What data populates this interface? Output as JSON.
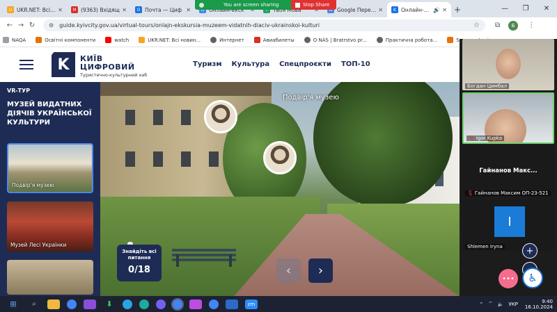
{
  "browser": {
    "tabs": [
      {
        "label": "UKR.NET: Всі но",
        "color": "#f5a623",
        "icon": "U"
      },
      {
        "label": "(9363) Вхідящ",
        "color": "#d93025",
        "icon": "M"
      },
      {
        "label": "Почта — Циф",
        "color": "#1a73e8",
        "icon": "O"
      },
      {
        "label": "Онлайн-екск",
        "color": "#4285f4",
        "icon": "O"
      },
      {
        "label": "Твоя Мова",
        "color": "#1fa463",
        "icon": "T"
      },
      {
        "label": "Google Перекл",
        "color": "#4285f4",
        "icon": "G"
      },
      {
        "label": "Онлайн-екс",
        "color": "#1a73e8",
        "icon": "K",
        "active": true
      }
    ],
    "new_tab": "+",
    "share": {
      "text": "You are screen sharing",
      "stop": "Stop Share"
    },
    "url": "guide.kyivcity.gov.ua/virtual-tours/onlajn-ekskursia-muzeem-vidatnih-diaciv-ukrainskoi-kulturi",
    "profile_initial": "Б",
    "bookmarks": [
      {
        "label": "NAQA",
        "color": "#9aa0a6"
      },
      {
        "label": "Освітні компоненти",
        "color": "#e8710a"
      },
      {
        "label": "watch",
        "color": "#ff0000"
      },
      {
        "label": "UKR.NET: Всі новин...",
        "color": "#f5a623"
      },
      {
        "label": "Интернет",
        "color": "#5f6368"
      },
      {
        "label": "Авиабилеты",
        "color": "#d93025"
      },
      {
        "label": "О NÁS | Bratrstvo pr...",
        "color": "#5f6368"
      },
      {
        "label": "Практична робота...",
        "color": "#5f6368"
      },
      {
        "label": "Scopus - Login",
        "color": "#e8710a"
      }
    ]
  },
  "site": {
    "brand_line1": "КИЇВ",
    "brand_line2": "ЦИФРОВИЙ",
    "brand_sub": "Туристично-культурний хаб",
    "logo_letter": "K",
    "menu": [
      "Туризм",
      "Культура",
      "Спецпроєкти",
      "ТОП-10"
    ],
    "sidebar": {
      "tag": "VR-ТУР",
      "title": "МУЗЕЙ ВИДАТНИХ ДІЯЧІВ УКРАЇНСЬКОЇ КУЛЬТУРИ",
      "cards": [
        "Подвір'я музею",
        "Музей Лесі Українки",
        ""
      ]
    },
    "location_title": "Подвір'я музею",
    "find": {
      "label": "Знайдіть всі питання",
      "count": "0/18"
    },
    "prev": "‹",
    "next": "›"
  },
  "zoom": {
    "participants": [
      {
        "name": "Богдан Цимбал"
      },
      {
        "name": "Igor Kupka",
        "muted": true
      },
      {
        "name": "Гайнанов Максим ОП-23-521",
        "display": "Гайнанов Макс...",
        "muted": true
      },
      {
        "name": "Shlemen Iryna",
        "initial": "I"
      }
    ]
  },
  "taskbar": {
    "lang": "УКР",
    "time": "9:40",
    "date": "16.10.2024"
  }
}
